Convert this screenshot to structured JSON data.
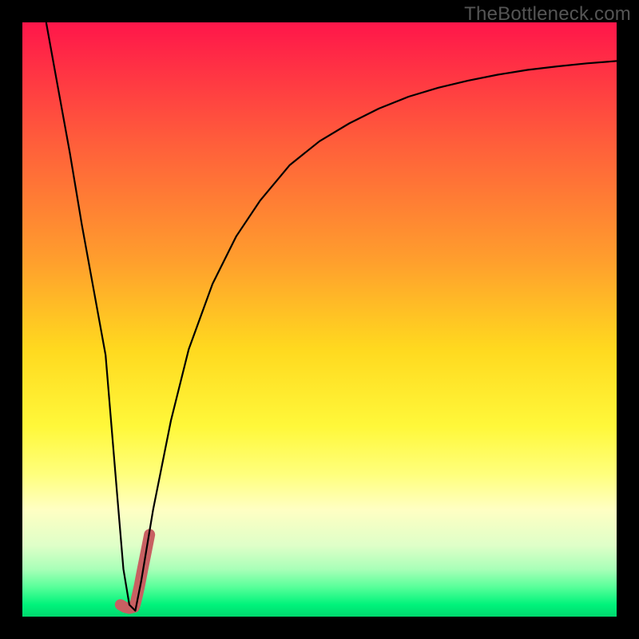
{
  "watermark": "TheBottleneck.com",
  "chart_data": {
    "type": "line",
    "title": "",
    "xlabel": "",
    "ylabel": "",
    "xlim": [
      0,
      100
    ],
    "ylim": [
      0,
      100
    ],
    "gradient": {
      "top_color": "#ff164a",
      "bottom_color": "#00d86e",
      "stops": [
        {
          "pos": 0.0,
          "color": "#ff164a"
        },
        {
          "pos": 0.2,
          "color": "#ff5d3b"
        },
        {
          "pos": 0.4,
          "color": "#ff9e2d"
        },
        {
          "pos": 0.55,
          "color": "#ffd91f"
        },
        {
          "pos": 0.68,
          "color": "#fff83a"
        },
        {
          "pos": 0.76,
          "color": "#ffff7c"
        },
        {
          "pos": 0.82,
          "color": "#ffffc3"
        },
        {
          "pos": 0.88,
          "color": "#dfffc8"
        },
        {
          "pos": 0.92,
          "color": "#a9ffb8"
        },
        {
          "pos": 0.95,
          "color": "#59ff9a"
        },
        {
          "pos": 0.98,
          "color": "#00f37b"
        },
        {
          "pos": 1.0,
          "color": "#00d86e"
        }
      ]
    },
    "series": [
      {
        "name": "main-curve",
        "color": "#000000",
        "x": [
          4,
          6,
          8,
          10,
          12,
          14,
          15,
          16,
          17,
          18,
          19,
          20,
          22,
          25,
          28,
          32,
          36,
          40,
          45,
          50,
          55,
          60,
          65,
          70,
          75,
          80,
          85,
          90,
          95,
          100
        ],
        "y": [
          100,
          89,
          78,
          66,
          55,
          44,
          32,
          20,
          8,
          2,
          1,
          6,
          18,
          33,
          45,
          56,
          64,
          70,
          76,
          80,
          83,
          85.5,
          87.5,
          89,
          90.2,
          91.2,
          92,
          92.6,
          93.1,
          93.5
        ]
      },
      {
        "name": "highlight-segment",
        "color": "#c86062",
        "x": [
          16.5,
          17.2,
          18.0,
          18.8,
          19.0,
          19.3,
          19.7,
          20.2,
          20.8,
          21.4
        ],
        "y": [
          2.0,
          1.6,
          1.4,
          1.6,
          2.2,
          3.4,
          5.2,
          7.8,
          10.8,
          13.8
        ]
      }
    ]
  }
}
